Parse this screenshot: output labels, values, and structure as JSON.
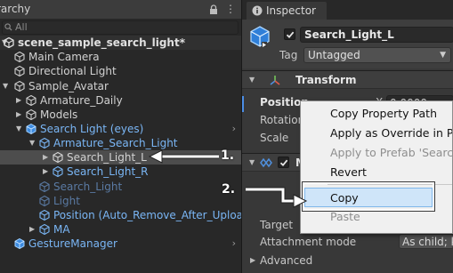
{
  "hierarchy": {
    "tab_title": "rarchy",
    "search_placeholder": "All",
    "scene": "scene_sample_search_light*",
    "items": [
      {
        "label": "Main Camera"
      },
      {
        "label": "Directional Light"
      },
      {
        "label": "Sample_Avatar"
      },
      {
        "label": "Armature_Daily"
      },
      {
        "label": "Models"
      },
      {
        "label": "Search Light (eyes)"
      },
      {
        "label": "Armature_Search_Light"
      },
      {
        "label": "Search_Light_L"
      },
      {
        "label": "Search_Light_R"
      },
      {
        "label": "Search_Light"
      },
      {
        "label": "Light"
      },
      {
        "label": "Position (Auto_Remove_After_Upload)"
      },
      {
        "label": "MA"
      },
      {
        "label": "GestureManager"
      }
    ]
  },
  "inspector": {
    "tab_title": "Inspector",
    "object_name": "Search_Light_L",
    "tag_label": "Tag",
    "tag_value": "Untagged",
    "transform_title": "Transform",
    "props": {
      "position": "Position",
      "rotation": "Rotation",
      "scale": "Scale",
      "target": "Target",
      "attachment_mode": "Attachment mode",
      "attachment_value": "As child; k",
      "advanced": "Advanced",
      "component2_title_partial": "M",
      "x_axis": "X",
      "position_x_partial": "0.0000"
    }
  },
  "context_menu": {
    "items": [
      {
        "label": "Copy Property Path",
        "enabled": true
      },
      {
        "label": "Apply as Override in Pre",
        "enabled": true
      },
      {
        "label": "Apply to Prefab 'Search",
        "enabled": false
      },
      {
        "label": "Revert",
        "enabled": true
      },
      {
        "label": "Copy",
        "enabled": true,
        "highlighted": true
      },
      {
        "label": "Paste",
        "enabled": false
      }
    ]
  },
  "annotations": {
    "step1": "1.",
    "step2": "2."
  },
  "colors": {
    "prefab_text": "#7ab6f5",
    "selection": "#4d4d4d",
    "menu_highlight": "#cfe5f9",
    "panel_bg": "#282828",
    "inspector_bg": "#383838"
  }
}
